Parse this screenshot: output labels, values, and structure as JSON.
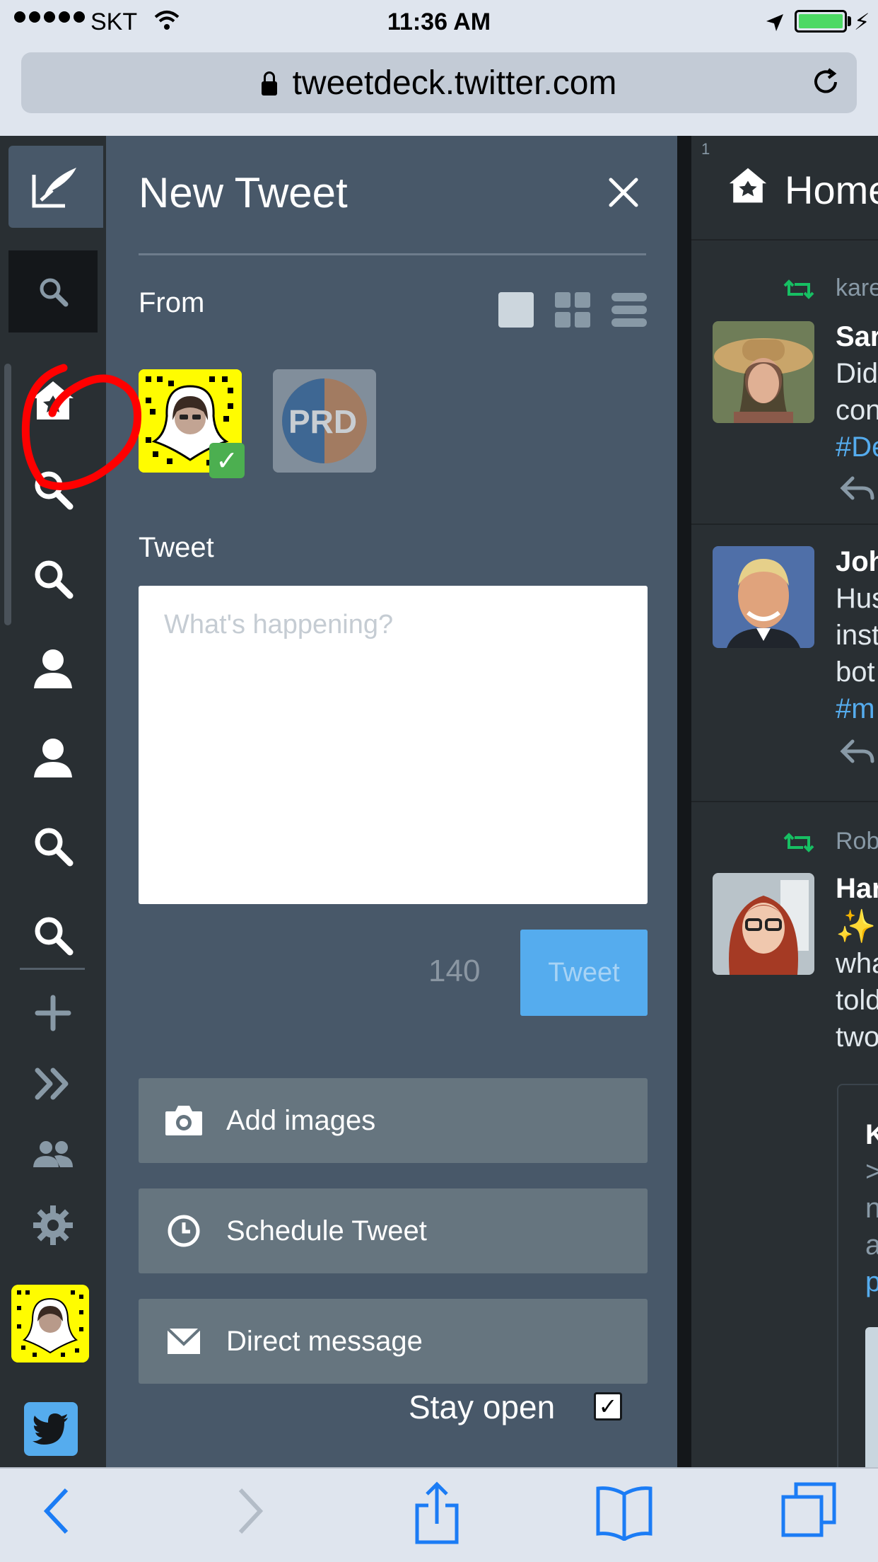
{
  "status_bar": {
    "carrier": "SKT",
    "time": "11:36 AM"
  },
  "browser": {
    "url": "tweetdeck.twitter.com"
  },
  "sidebar": {
    "items": [
      {
        "icon": "compose-icon",
        "active": true
      },
      {
        "icon": "search-icon",
        "active": true
      },
      {
        "icon": "home-icon"
      },
      {
        "icon": "search-icon"
      },
      {
        "icon": "search-icon"
      },
      {
        "icon": "user-icon"
      },
      {
        "icon": "user-icon"
      },
      {
        "icon": "search-icon"
      },
      {
        "icon": "search-icon"
      },
      {
        "icon": "plus-icon"
      },
      {
        "icon": "expand-icon"
      },
      {
        "icon": "accounts-icon"
      },
      {
        "icon": "settings-icon"
      }
    ]
  },
  "compose": {
    "title": "New Tweet",
    "from_label": "From",
    "tweet_label": "Tweet",
    "placeholder": "What's happening?",
    "char_count": "140",
    "tweet_button": "Tweet",
    "accounts": [
      {
        "name": "snapcode-avatar",
        "selected": true
      },
      {
        "name": "PRD",
        "selected": false
      }
    ],
    "prd_logo_text": "PRD",
    "actions": {
      "add_images": "Add images",
      "schedule": "Schedule Tweet",
      "direct_message": "Direct message"
    },
    "stay_open_label": "Stay open",
    "stay_open_checked": true
  },
  "column": {
    "number": "1",
    "title": "Home",
    "tweets": [
      {
        "retweeted_by": "kare",
        "name": "Sar",
        "lines": [
          "Did",
          "con"
        ],
        "tag": "#De"
      },
      {
        "retweeted_by": "",
        "name": "Joh",
        "lines": [
          "Hus",
          "inst",
          "bot"
        ],
        "tag": "#m"
      },
      {
        "retweeted_by": "Rob",
        "name": "Har",
        "lines": [
          "wha",
          "told",
          "two"
        ],
        "tag": ""
      }
    ],
    "quote": {
      "name": "K",
      "lines": [
        ">",
        "n",
        "a"
      ],
      "link": "p"
    }
  },
  "colors": {
    "accent": "#55acee",
    "panel": "#485869",
    "navbar": "#292f33",
    "retweet": "#17bf63",
    "annotation": "#ff0000"
  }
}
